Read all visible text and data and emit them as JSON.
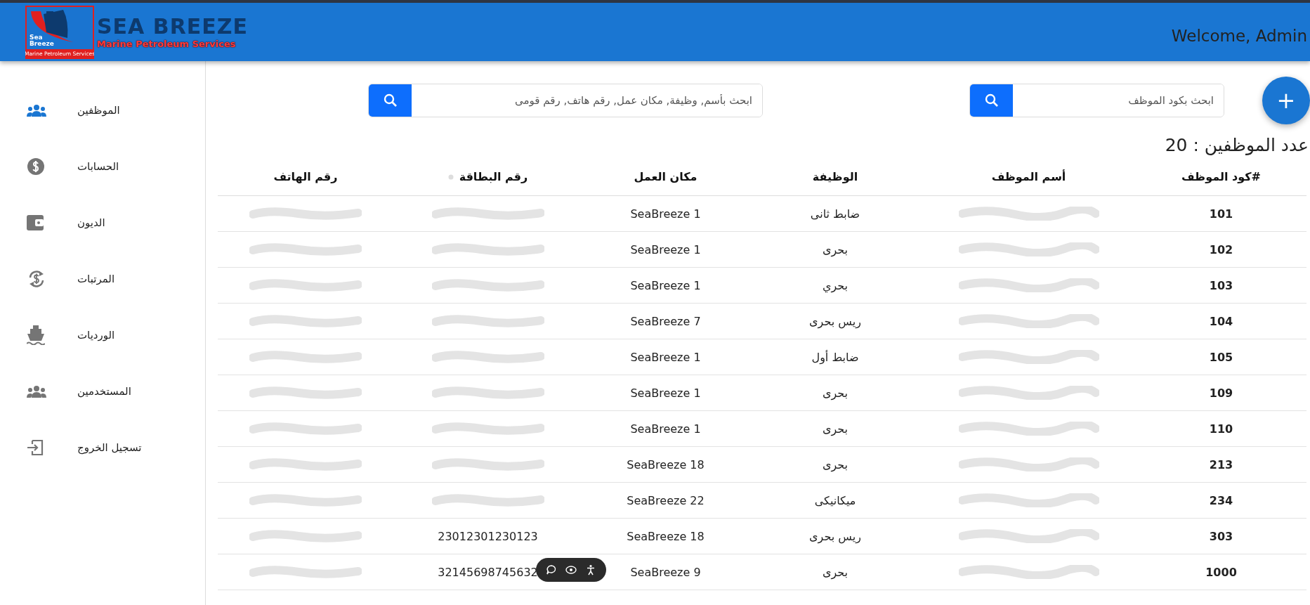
{
  "header": {
    "logo": {
      "mark_lines": [
        "Sea",
        "Breeze"
      ],
      "mark_tagline": "Marine Petroleum Services",
      "title": "SEA BREEZE",
      "tagline": "Marine Petroleum Services"
    },
    "welcome": "Welcome, Admin"
  },
  "sidebar": {
    "items": [
      {
        "label": "الموظفين",
        "selected": true
      },
      {
        "label": "الحسابات",
        "selected": false
      },
      {
        "label": "الديون",
        "selected": false
      },
      {
        "label": "المرتبات",
        "selected": false
      },
      {
        "label": "الورديات",
        "selected": false
      },
      {
        "label": "المستخدمين",
        "selected": false
      },
      {
        "label": "تسجيل الخروج",
        "selected": false
      }
    ]
  },
  "add_button": {
    "label": "+"
  },
  "search_code": {
    "placeholder": "ابحث بكود الموظف"
  },
  "search_all": {
    "placeholder": "ابحث بأسم, وظيفة, مكان عمل, رقم هاتف, رقم قومى"
  },
  "count": "عدد الموظفين : 20",
  "table": {
    "columns": [
      "#كود الموظف",
      "أسم الموظف",
      "الوظيفة",
      "مكان العمل",
      "رقم البطاقة",
      "رقم الهاتف"
    ],
    "rows": [
      {
        "code": "101",
        "name": {
          "redacted": true
        },
        "job": "ضابط ثانى",
        "place": "SeaBreeze 1",
        "card": {
          "redacted": true
        },
        "phone": {
          "redacted": true
        }
      },
      {
        "code": "102",
        "name": {
          "redacted": true
        },
        "job": "بحرى",
        "place": "SeaBreeze 1",
        "card": {
          "redacted": true
        },
        "phone": {
          "redacted": true
        }
      },
      {
        "code": "103",
        "name": {
          "redacted": true
        },
        "job": "بحري",
        "place": "SeaBreeze 1",
        "card": {
          "redacted": true
        },
        "phone": {
          "redacted": true
        }
      },
      {
        "code": "104",
        "name": {
          "redacted": true
        },
        "job": "ريس بحرى",
        "place": "SeaBreeze 7",
        "card": {
          "redacted": true
        },
        "phone": {
          "redacted": true
        }
      },
      {
        "code": "105",
        "name": {
          "redacted": true
        },
        "job": "ضابط أول",
        "place": "SeaBreeze 1",
        "card": {
          "redacted": true
        },
        "phone": {
          "redacted": true
        }
      },
      {
        "code": "109",
        "name": {
          "redacted": true
        },
        "job": "بحرى",
        "place": "SeaBreeze 1",
        "card": {
          "redacted": true
        },
        "phone": {
          "redacted": true
        }
      },
      {
        "code": "110",
        "name": {
          "redacted": true
        },
        "job": "بحرى",
        "place": "SeaBreeze 1",
        "card": {
          "redacted": true
        },
        "phone": {
          "redacted": true
        }
      },
      {
        "code": "213",
        "name": {
          "redacted": true
        },
        "job": "بحرى",
        "place": "SeaBreeze 18",
        "card": {
          "redacted": true
        },
        "phone": {
          "redacted": true
        }
      },
      {
        "code": "234",
        "name": {
          "redacted": true
        },
        "job": "ميكانيكى",
        "place": "SeaBreeze 22",
        "card": {
          "redacted": true
        },
        "phone": {
          "redacted": true
        }
      },
      {
        "code": "303",
        "name": {
          "redacted": true
        },
        "job": "ريس بحرى",
        "place": "SeaBreeze 18",
        "card": {
          "text": "23012301230123",
          "redacted": false
        },
        "phone": {
          "redacted": true
        }
      },
      {
        "code": "1000",
        "name": {
          "redacted": true
        },
        "job": "بحرى",
        "place": "SeaBreeze 9",
        "card": {
          "text": "32145698745632",
          "redacted": false
        },
        "phone": {
          "redacted": true
        }
      }
    ]
  }
}
